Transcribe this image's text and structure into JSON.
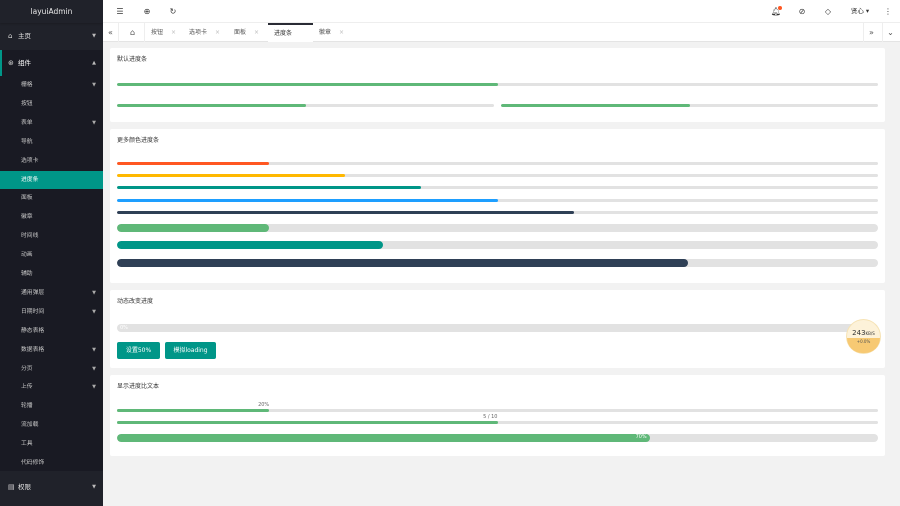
{
  "app": {
    "title": "layuiAdmin"
  },
  "sidebar": {
    "home": "主页",
    "components": "组件",
    "items": [
      "栅格",
      "按钮",
      "表单",
      "导航",
      "选项卡",
      "进度条",
      "面板",
      "徽章",
      "时间线",
      "动画",
      "辅助",
      "通用弹层",
      "日期时间",
      "静态表格",
      "数据表格",
      "分页",
      "上传",
      "轮播",
      "流加载",
      "工具",
      "代码修饰"
    ],
    "active_index": 5,
    "expandable": [
      0,
      2,
      11,
      12,
      14,
      15,
      16
    ],
    "permissions": "权限"
  },
  "tabs": {
    "items": [
      {
        "label": "按钮"
      },
      {
        "label": "选项卡"
      },
      {
        "label": "面板"
      },
      {
        "label": "进度条"
      },
      {
        "label": "徽章"
      }
    ],
    "active_index": 3
  },
  "cards": {
    "default": {
      "title": "默认进度条",
      "bars": [
        0.5,
        0.5,
        0.5
      ]
    },
    "colors": {
      "title": "更多颜色进度条",
      "bars": [
        {
          "percent": 0.2,
          "color": "#ff5722"
        },
        {
          "percent": 0.3,
          "color": "#ffb800"
        },
        {
          "percent": 0.4,
          "color": "#009688"
        },
        {
          "percent": 0.5,
          "color": "#1e9fff"
        },
        {
          "percent": 0.6,
          "color": "#2f4056"
        },
        {
          "percent": 0.2,
          "color": "#5fb878"
        },
        {
          "percent": 0.35,
          "color": "#009688"
        },
        {
          "percent": 0.75,
          "color": "#2f4056"
        }
      ]
    },
    "dynamic": {
      "title": "动态改变进度",
      "percent_label": "0%",
      "btn_set": "设置50%",
      "btn_loading": "模拟loading"
    },
    "text": {
      "title": "显示进度比文本",
      "bar1_label": "20%",
      "bar2_label": "5 / 10",
      "bar3_label": "70%",
      "bar1": 0.2,
      "bar2": 0.5,
      "bar3": 0.7
    }
  },
  "speed_widget": {
    "value": "243",
    "unit": "KB/S",
    "sub": "+0.0%"
  },
  "colors": {
    "accent": "#009688",
    "sidebar_bg": "#20222a",
    "green": "#5fb878"
  }
}
